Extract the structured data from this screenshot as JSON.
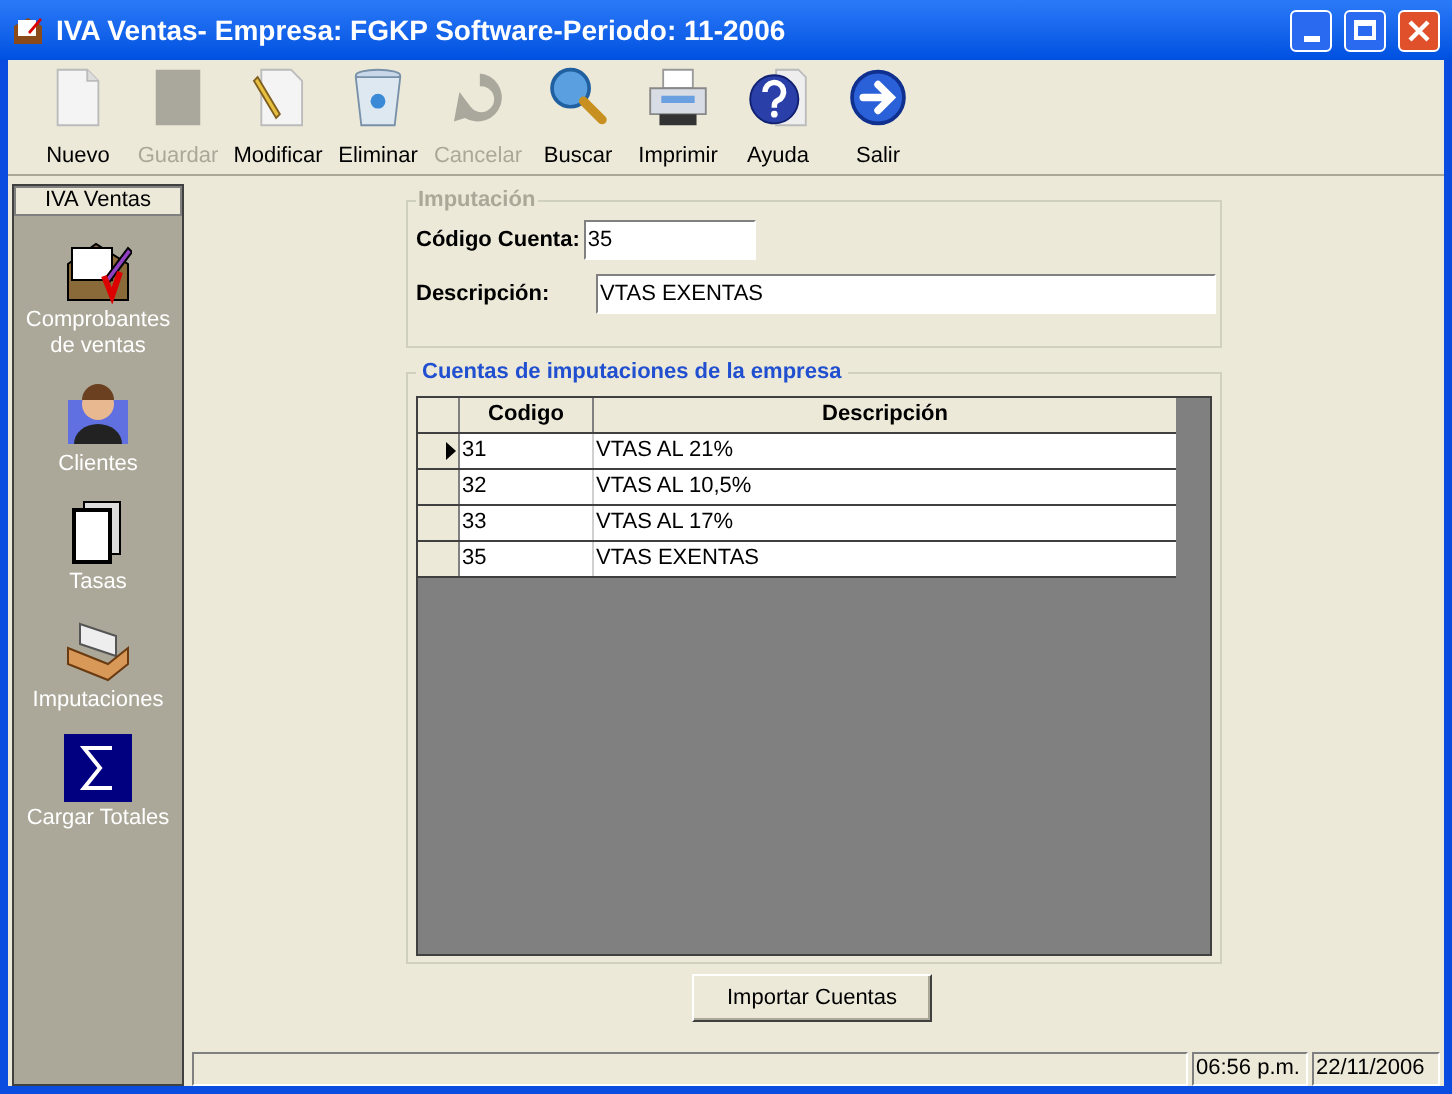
{
  "window": {
    "title": "IVA Ventas- Empresa: FGKP Software-Periodo: 11-2006"
  },
  "toolbar": [
    {
      "label": "Nuevo",
      "kind": "new",
      "disabled": false
    },
    {
      "label": "Guardar",
      "kind": "save",
      "disabled": true
    },
    {
      "label": "Modificar",
      "kind": "edit",
      "disabled": false
    },
    {
      "label": "Eliminar",
      "kind": "trash",
      "disabled": false
    },
    {
      "label": "Cancelar",
      "kind": "undo",
      "disabled": true
    },
    {
      "label": "Buscar",
      "kind": "search",
      "disabled": false
    },
    {
      "label": "Imprimir",
      "kind": "print",
      "disabled": false
    },
    {
      "label": "Ayuda",
      "kind": "help",
      "disabled": false
    },
    {
      "label": "Salir",
      "kind": "exit",
      "disabled": false
    }
  ],
  "sidebar": {
    "title": "IVA Ventas",
    "items": [
      {
        "label": "Comprobantes de ventas",
        "kind": "voucher"
      },
      {
        "label": "Clientes",
        "kind": "person"
      },
      {
        "label": "Tasas",
        "kind": "pages"
      },
      {
        "label": "Imputaciones",
        "kind": "cards"
      },
      {
        "label": "Cargar Totales",
        "kind": "sum"
      }
    ]
  },
  "imputacion": {
    "title": "Imputación",
    "codigo_label": "Código Cuenta:",
    "codigo_value": "35",
    "descripcion_label": "Descripción:",
    "descripcion_value": "VTAS EXENTAS"
  },
  "cuentas": {
    "title": "Cuentas de imputaciones de la empresa",
    "columns": [
      "Codigo",
      "Descripción"
    ],
    "rows": [
      {
        "codigo": "31",
        "descripcion": "VTAS AL 21%",
        "selected": true
      },
      {
        "codigo": "32",
        "descripcion": "VTAS AL 10,5%",
        "selected": false
      },
      {
        "codigo": "33",
        "descripcion": "VTAS AL 17%",
        "selected": false
      },
      {
        "codigo": "35",
        "descripcion": "VTAS EXENTAS",
        "selected": false
      }
    ]
  },
  "import_button": "Importar Cuentas",
  "status_bar": {
    "time": "06:56 p.m.",
    "date": "22/11/2006"
  }
}
